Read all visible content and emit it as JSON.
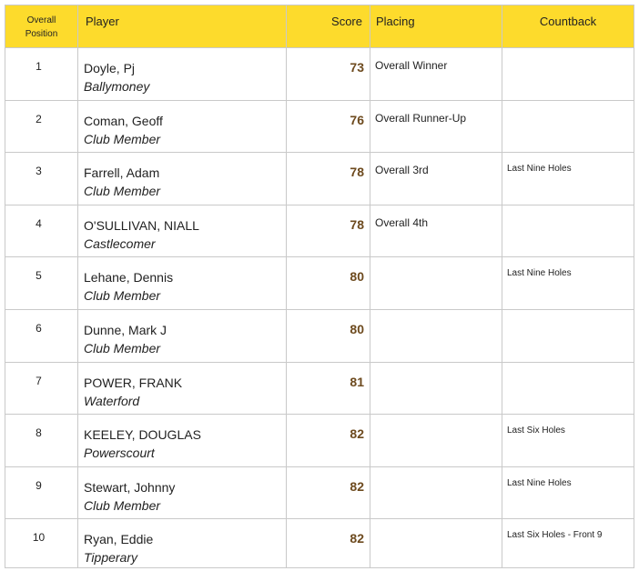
{
  "header": {
    "position_line1": "Overall",
    "position_line2": "Position",
    "player": "Player",
    "score": "Score",
    "placing": "Placing",
    "countback": "Countback"
  },
  "rows": [
    {
      "position": "1",
      "name": "Doyle, Pj",
      "club": "Ballymoney",
      "score": "73",
      "placing": "Overall Winner",
      "countback": ""
    },
    {
      "position": "2",
      "name": "Coman, Geoff",
      "club": "Club Member",
      "score": "76",
      "placing": "Overall Runner-Up",
      "countback": ""
    },
    {
      "position": "3",
      "name": "Farrell, Adam",
      "club": "Club Member",
      "score": "78",
      "placing": "Overall 3rd",
      "countback": "Last Nine Holes"
    },
    {
      "position": "4",
      "name": "O'SULLIVAN, NIALL",
      "club": "Castlecomer",
      "score": "78",
      "placing": "Overall 4th",
      "countback": ""
    },
    {
      "position": "5",
      "name": "Lehane, Dennis",
      "club": "Club Member",
      "score": "80",
      "placing": "",
      "countback": "Last Nine Holes"
    },
    {
      "position": "6",
      "name": "Dunne, Mark J",
      "club": "Club Member",
      "score": "80",
      "placing": "",
      "countback": ""
    },
    {
      "position": "7",
      "name": "POWER, FRANK",
      "club": "Waterford",
      "score": "81",
      "placing": "",
      "countback": ""
    },
    {
      "position": "8",
      "name": "KEELEY, DOUGLAS",
      "club": "Powerscourt",
      "score": "82",
      "placing": "",
      "countback": "Last Six Holes"
    },
    {
      "position": "9",
      "name": "Stewart, Johnny",
      "club": "Club Member",
      "score": "82",
      "placing": "",
      "countback": "Last Nine Holes"
    },
    {
      "position": "10",
      "name": "Ryan, Eddie",
      "club": "Tipperary",
      "score": "82",
      "placing": "",
      "countback": "Last Six Holes - Front 9"
    }
  ],
  "colors": {
    "header_background": "#fddb2c",
    "score_text": "#6d4a1e",
    "grid_border": "#c9c9c9"
  }
}
